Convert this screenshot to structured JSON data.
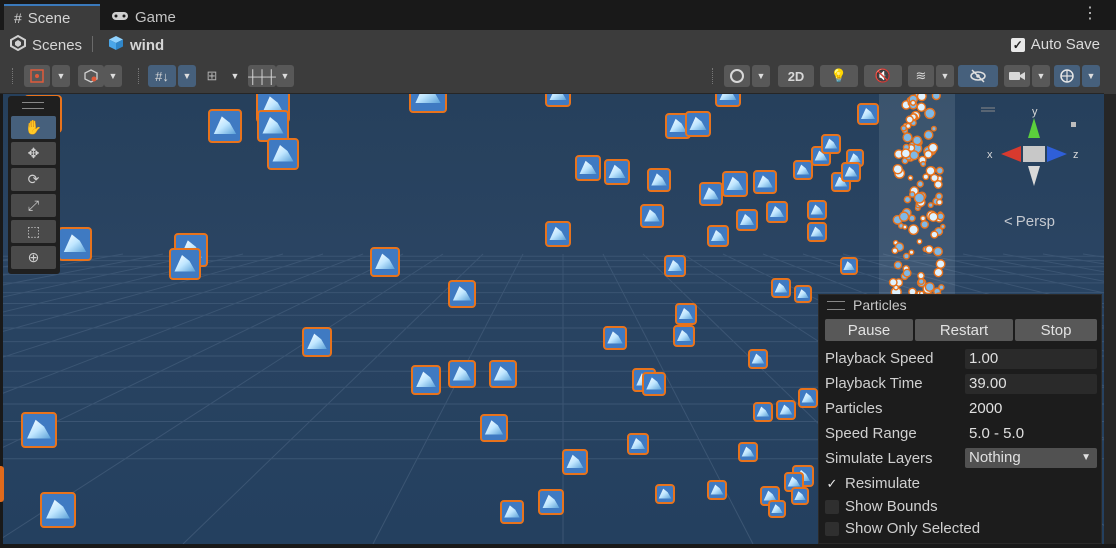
{
  "tabs": [
    {
      "label": "Scene",
      "icon": "grid-icon",
      "active": true
    },
    {
      "label": "Game",
      "icon": "gamepad-icon",
      "active": false
    }
  ],
  "breadcrumb": {
    "root": "Scenes",
    "current": "wind"
  },
  "autosave": {
    "label": "Auto Save",
    "checked": true
  },
  "toolbar": {
    "mode_2d": "2D"
  },
  "scene": {
    "camera_label": "Persp",
    "sky_color": "#273f5a",
    "grid_color": "#3b5573",
    "particle_outline": "#e8731c"
  },
  "gizmo_axes": {
    "x": "x",
    "y": "y",
    "z": "z"
  },
  "particles_panel": {
    "title": "Particles",
    "buttons": {
      "pause": "Pause",
      "restart": "Restart",
      "stop": "Stop"
    },
    "rows": [
      {
        "label": "Playback Speed",
        "value": "1.00"
      },
      {
        "label": "Playback Time",
        "value": "39.00"
      },
      {
        "label": "Particles",
        "value": "2000"
      },
      {
        "label": "Speed Range",
        "value": "5.0 - 5.0"
      },
      {
        "label": "Simulate Layers",
        "value": "Nothing"
      }
    ],
    "checks": [
      {
        "label": "Resimulate",
        "checked": true
      },
      {
        "label": "Show Bounds",
        "checked": false
      },
      {
        "label": "Show Only Selected",
        "checked": false
      }
    ]
  },
  "colors": {
    "accent_blue": "#3a79bb",
    "button_blue": "#46607c"
  }
}
